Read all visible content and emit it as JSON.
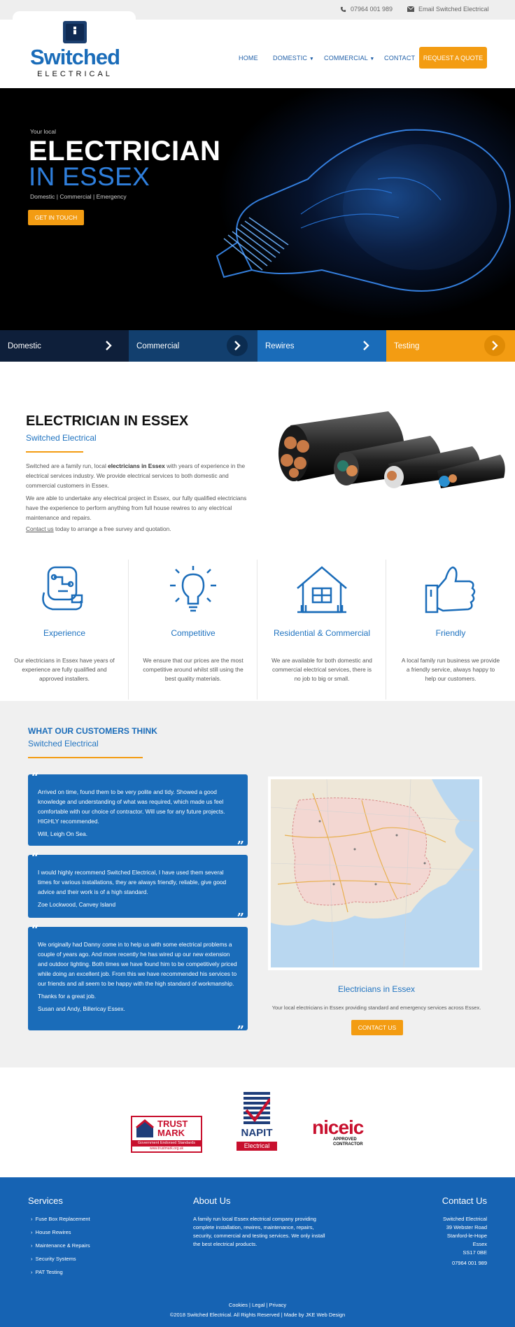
{
  "topbar": {
    "phone": "07964 001 989",
    "email": "Email Switched Electrical"
  },
  "logo": {
    "name": "Switched",
    "sub": "ELECTRICAL"
  },
  "nav": {
    "home": "HOME",
    "domestic": "DOMESTIC",
    "commercial": "COMMERCIAL",
    "contact": "CONTACT",
    "quote": "REQUEST A QUOTE"
  },
  "hero": {
    "kicker": "Your local",
    "title1": "ELECTRICIAN",
    "title2": "IN ESSEX",
    "tagline": "Domestic | Commercial | Emergency",
    "cta": "GET IN TOUCH"
  },
  "services": [
    {
      "label": "Domestic",
      "color": "#0e1f3a"
    },
    {
      "label": "Commercial",
      "color": "#123f6e"
    },
    {
      "label": "Rewires",
      "color": "#1a6cb9"
    },
    {
      "label": "Testing",
      "color": "#f39c12"
    }
  ],
  "intro": {
    "title": "ELECTRICIAN IN ESSEX",
    "subtitle": "Switched Electrical",
    "p1a": "Switched are a family run, local ",
    "p1b": "electricians in Essex",
    "p1c": " with years of experience in the electrical services industry. We provide electrical services to both domestic and commercial customers in Essex.",
    "p2": "We are able to undertake any electrical project in Essex, our fully qualified electricians have the experience to perform anything from full house rewires to any electrical maintenance and repairs.",
    "p3a": "Contact us",
    "p3b": " today to arrange a free survey and quotation."
  },
  "features": [
    {
      "title": "Experience",
      "text": "Our electricians in Essex have years of experience are fully qualified and approved installers.",
      "icon": "wiring-icon"
    },
    {
      "title": "Competitive",
      "text": "We ensure that our prices are the most competitive around whilst still using the best quality materials.",
      "icon": "lightbulb-icon"
    },
    {
      "title": "Residential & Commercial",
      "text": "We are available for both domestic and commercial electrical services, there is no job to big or small.",
      "icon": "house-icon"
    },
    {
      "title": "Friendly",
      "text": "A local family run business we provide a friendly service, always happy to help our customers.",
      "icon": "thumbs-up-icon"
    }
  ],
  "testimonials": {
    "title": "WHAT OUR CUSTOMERS THINK",
    "subtitle": "Switched Electrical",
    "items": [
      {
        "text": "Arrived on time, found them to be very polite and tidy. Showed a good knowledge and understanding of what was required, which made us feel comfortable with our choice of contractor. Will use for any future projects. HIGHLY recommended.",
        "author": "Will, Leigh On Sea."
      },
      {
        "text": "I would highly recommend Switched Electrical, I have used them several times for various installations, they are always friendly, reliable, give good advice and their work is of a high standard.",
        "author": "Zoe Lockwood, Canvey Island"
      },
      {
        "text": "We originally had Danny come in to help us with some electrical problems a couple of years ago. And more recently he has wired up our new extension and outdoor lighting. Both times we have found him to be competitively priced while doing an excellent job. From this we have recommended his services to our friends and all seem to be happy with the high standard of workmanship.",
        "extra": "Thanks for a great job.",
        "author": "Susan and Andy, Billericay Essex."
      }
    ],
    "map_title": "Electricians in Essex",
    "map_text": "Your local electricians in Essex providing standard and emergency services across Essex.",
    "map_cta": "CONTACT US"
  },
  "accreditations": {
    "trustmark": "TRUST MARK",
    "trustmark_sub": "Government Endorsed Standards",
    "trustmark_url": "www.trustmark.org.uk",
    "napit": "NAPIT",
    "napit_sub": "Electrical",
    "niceic": "niceic",
    "niceic_sub1": "APPROVED",
    "niceic_sub2": "CONTRACTOR"
  },
  "footer": {
    "services_title": "Services",
    "services": [
      "Fuse Box Replacement",
      "House Rewires",
      "Maintenance & Repairs",
      "Security Systems",
      "PAT Testing"
    ],
    "about_title": "About Us",
    "about_text": "A family run local Essex electrical company providing complete installation, rewires, maintenance, repairs, security, commercial and testing services. We only install the best electrical products.",
    "contact_title": "Contact Us",
    "address": [
      "Switched Electrical",
      "39 Webster Road",
      "Stanford-le-Hope",
      "Essex",
      "SS17 0BE"
    ],
    "phone": "07964 001 989",
    "links": "Cookies | Legal | Privacy",
    "copyright": "©2018 Switched Electrical. All Rights Reserved | Made by JKE Web Design"
  }
}
